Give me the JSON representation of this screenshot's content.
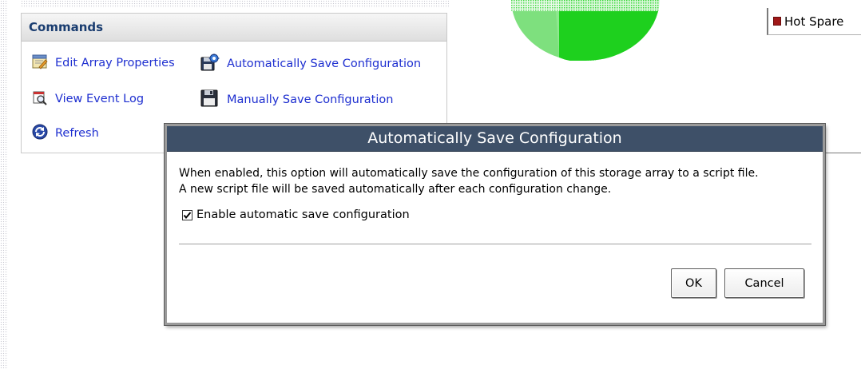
{
  "commands_panel": {
    "title": "Commands",
    "items": [
      {
        "label": "Edit Array Properties",
        "icon": "edit-properties-icon"
      },
      {
        "label": "Automatically Save Configuration",
        "icon": "auto-save-icon"
      },
      {
        "label": "View Event Log",
        "icon": "event-log-icon"
      },
      {
        "label": "Manually Save Configuration",
        "icon": "floppy-disk-icon"
      },
      {
        "label": "Refresh",
        "icon": "refresh-icon"
      }
    ]
  },
  "legend": {
    "hot_spare_label": "Hot Spare",
    "hot_spare_color": "#a01818"
  },
  "dialog": {
    "title": "Automatically Save Configuration",
    "description_line1": "When enabled, this option will automatically save the configuration of this storage array to a script file.",
    "description_line2": "A new script file will be saved automatically after each configuration change.",
    "checkbox_label": "Enable automatic save configuration",
    "checkbox_checked": true,
    "ok_label": "OK",
    "cancel_label": "Cancel"
  },
  "colors": {
    "title_bar": "#3e5068",
    "link": "#1e2fd0",
    "header_text": "#1a3d70",
    "pie_green": "#1ed01e"
  }
}
